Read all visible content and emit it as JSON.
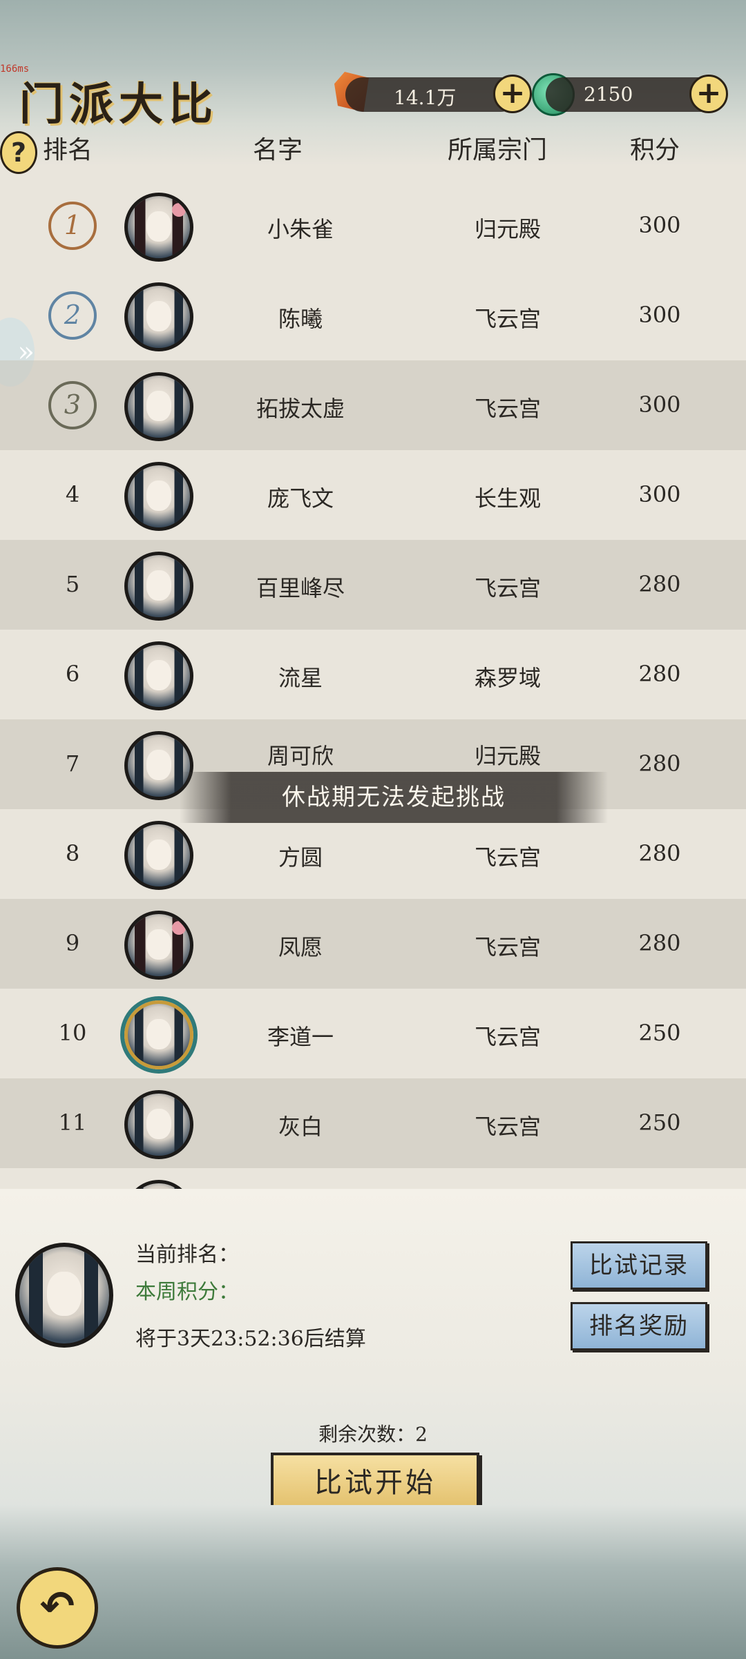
{
  "debug": {
    "fps_label": "166ms"
  },
  "header": {
    "title": "门派大比",
    "currency_a": {
      "value": "14.1万",
      "icon": "copper-gem-icon"
    },
    "currency_b": {
      "value": "2150",
      "icon": "jade-coin-icon"
    }
  },
  "columns": {
    "rank": "排名",
    "name": "名字",
    "sect": "所属宗门",
    "score": "积分"
  },
  "rows": [
    {
      "rank": "1",
      "name": "小朱雀",
      "sect": "归元殿",
      "score": "300"
    },
    {
      "rank": "2",
      "name": "陈曦",
      "sect": "飞云宫",
      "score": "300"
    },
    {
      "rank": "3",
      "name": "拓拔太虚",
      "sect": "飞云宫",
      "score": "300"
    },
    {
      "rank": "4",
      "name": "庞飞文",
      "sect": "长生观",
      "score": "300"
    },
    {
      "rank": "5",
      "name": "百里峰尽",
      "sect": "飞云宫",
      "score": "280"
    },
    {
      "rank": "6",
      "name": "流星",
      "sect": "森罗域",
      "score": "280"
    },
    {
      "rank": "7",
      "name": "周可欣",
      "sect": "归元殿",
      "score": "280"
    },
    {
      "rank": "8",
      "name": "方圆",
      "sect": "飞云宫",
      "score": "280"
    },
    {
      "rank": "9",
      "name": "凤愿",
      "sect": "飞云宫",
      "score": "280"
    },
    {
      "rank": "10",
      "name": "李道一",
      "sect": "飞云宫",
      "score": "250"
    },
    {
      "rank": "11",
      "name": "灰白",
      "sect": "飞云宫",
      "score": "250"
    }
  ],
  "toast": "休战期无法发起挑战",
  "me": {
    "current_rank_label": "当前排名：",
    "weekly_score_label": "本周积分：",
    "settle_text": "将于3天23:52:36后结算"
  },
  "buttons": {
    "records": "比试记录",
    "rewards": "排名奖励",
    "start": "比试开始",
    "back": "返回"
  },
  "remaining": "剩余次数：2"
}
